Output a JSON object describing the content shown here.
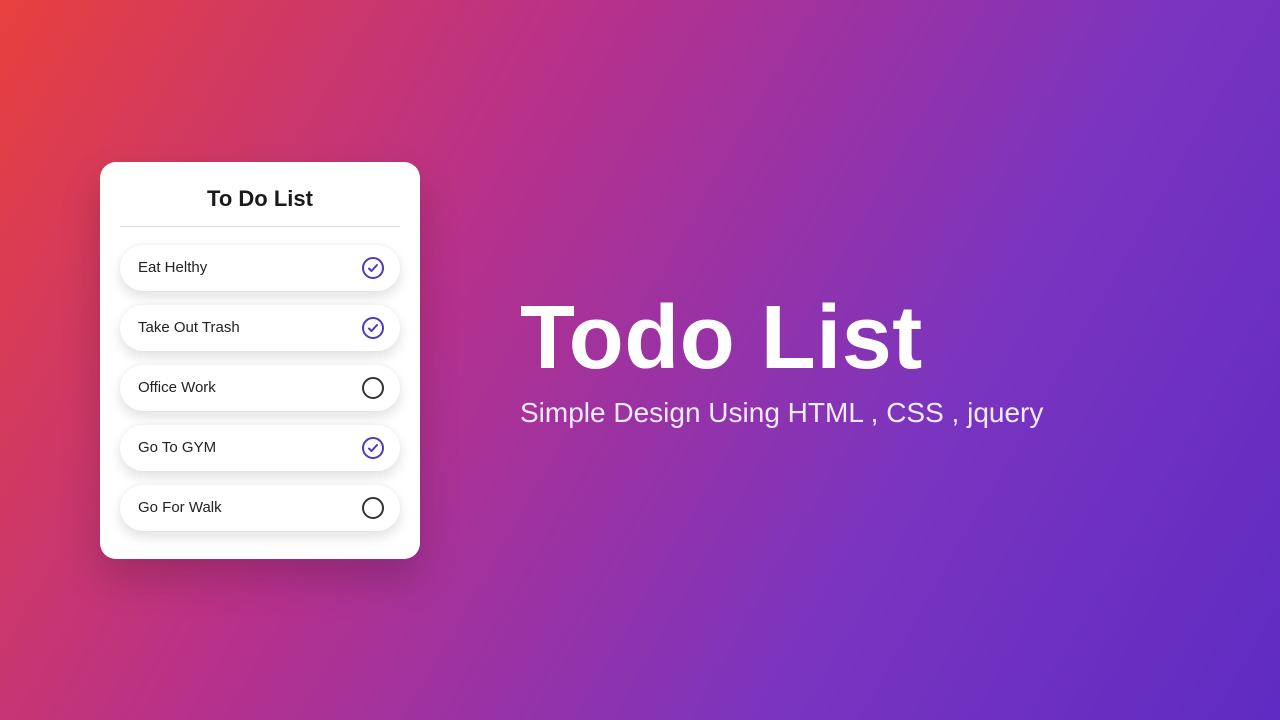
{
  "card": {
    "title": "To Do List",
    "items": [
      {
        "label": "Eat Helthy",
        "checked": true
      },
      {
        "label": "Take Out Trash",
        "checked": true
      },
      {
        "label": "Office Work",
        "checked": false
      },
      {
        "label": "Go To GYM",
        "checked": true
      },
      {
        "label": "Go For Walk",
        "checked": false
      }
    ]
  },
  "hero": {
    "title": "Todo List",
    "subtitle": "Simple Design Using HTML , CSS , jquery"
  },
  "icons": {
    "checked_name": "check-circle-icon",
    "unchecked_name": "circle-icon"
  }
}
